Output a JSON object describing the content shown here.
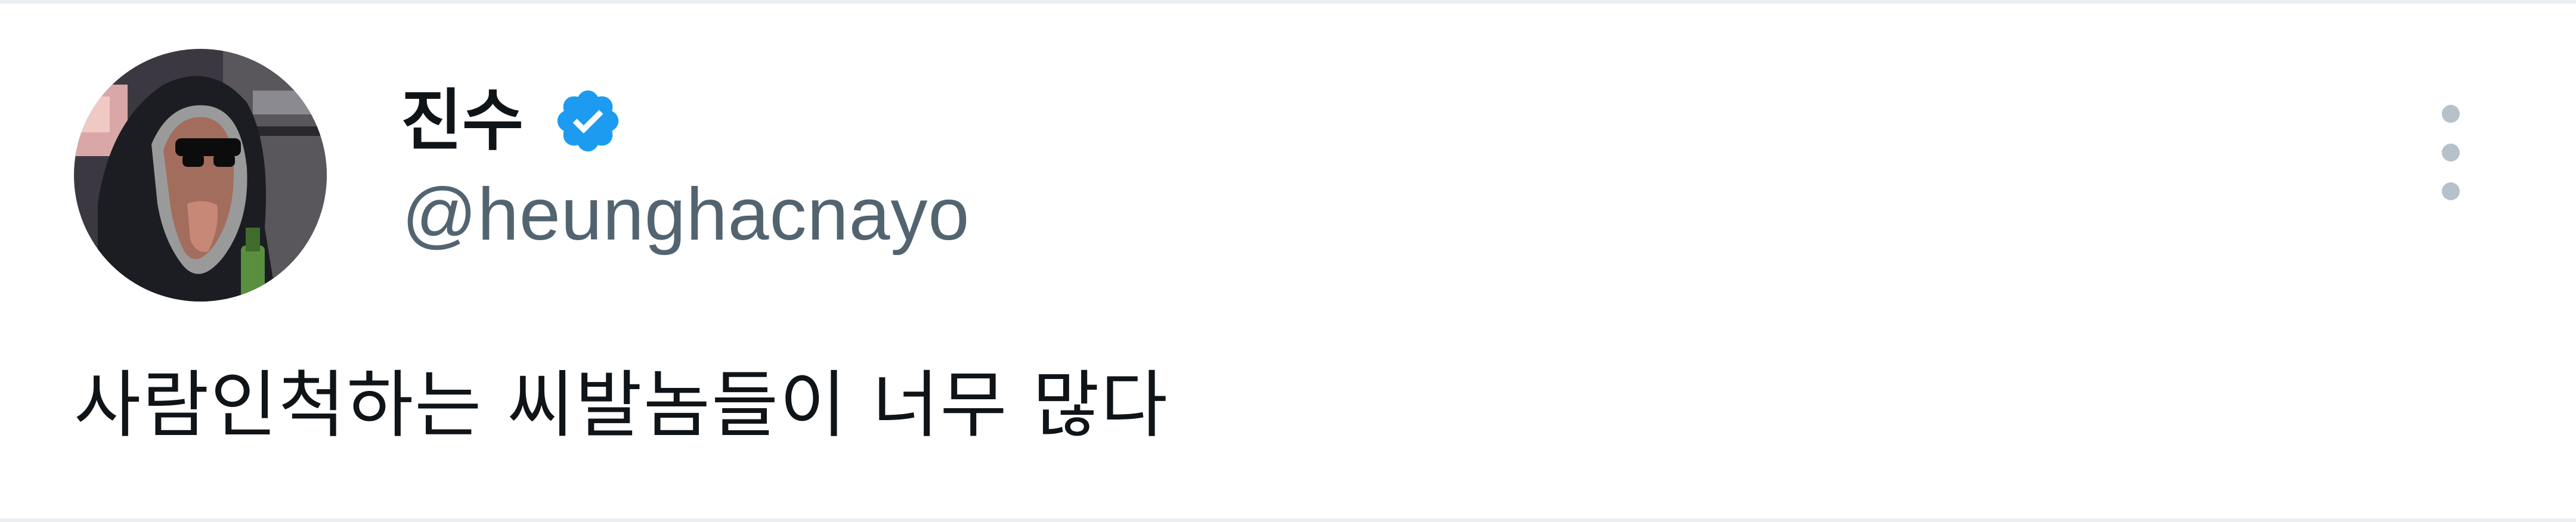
{
  "tweet": {
    "display_name": "진수",
    "handle": "@heunghacnayo",
    "text": "사람인척하는 씨발놈들이 너무 많다",
    "verified": true
  },
  "icons": {
    "verified": "verified-badge-icon",
    "more": "more-options-icon",
    "avatar": "profile-avatar"
  },
  "colors": {
    "verified_blue": "#1d9bf0",
    "name": "#0f1419",
    "handle": "#536471",
    "more_dots": "#b6c1c9"
  }
}
